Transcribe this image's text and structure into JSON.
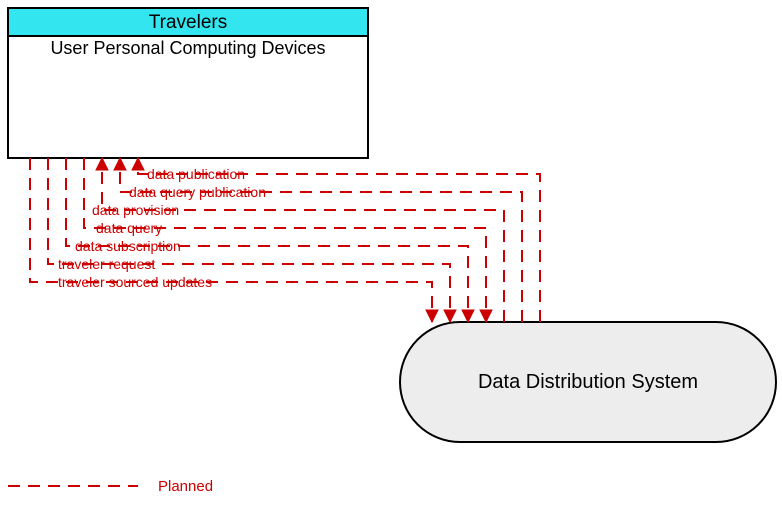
{
  "nodes": {
    "travelers": {
      "title": "Travelers",
      "subtitle": "User Personal Computing Devices"
    },
    "dds": {
      "title": "Data Distribution System"
    }
  },
  "flows": [
    {
      "label": "data publication",
      "direction": "to_travelers"
    },
    {
      "label": "data query publication",
      "direction": "to_travelers"
    },
    {
      "label": "data provision",
      "direction": "to_travelers"
    },
    {
      "label": "data query",
      "direction": "to_dds"
    },
    {
      "label": "data subscription",
      "direction": "to_dds"
    },
    {
      "label": "traveler request",
      "direction": "to_dds"
    },
    {
      "label": "traveler sourced updates",
      "direction": "to_dds"
    }
  ],
  "legend": {
    "planned": "Planned"
  },
  "colors": {
    "cyan": "#33e5ee",
    "flow": "#cc0000",
    "grey": "#ededed"
  }
}
